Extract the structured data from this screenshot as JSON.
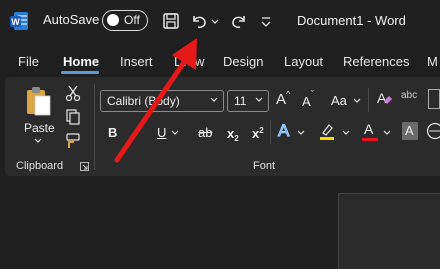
{
  "titlebar": {
    "app_icon": "word-icon",
    "autosave_label": "AutoSave",
    "autosave_state": "Off",
    "document_title": "Document1  -  Word"
  },
  "tabs": [
    {
      "label": "File"
    },
    {
      "label": "Home"
    },
    {
      "label": "Insert"
    },
    {
      "label": "Draw"
    },
    {
      "label": "Design"
    },
    {
      "label": "Layout"
    },
    {
      "label": "References"
    },
    {
      "label": "M"
    }
  ],
  "clipboard": {
    "paste_label": "Paste",
    "group_label": "Clipboard"
  },
  "font": {
    "name": "Calibri (Body)",
    "size": "11",
    "group_label": "Font",
    "bold": "B",
    "italic": "I",
    "underline": "U",
    "strike": "ab",
    "subscript": "x",
    "subscript_small": "2",
    "superscript": "x",
    "superscript_small": "2",
    "grow": "A",
    "shrink": "A",
    "change_case": "Aa",
    "effects": "A",
    "font_color": "A",
    "shading": "A",
    "phonetic": "abc"
  },
  "colors": {
    "annotation_arrow": "#e61919",
    "highlight": "#ffd700",
    "font_color": "#e81123",
    "accent": "#5b9bd5"
  }
}
